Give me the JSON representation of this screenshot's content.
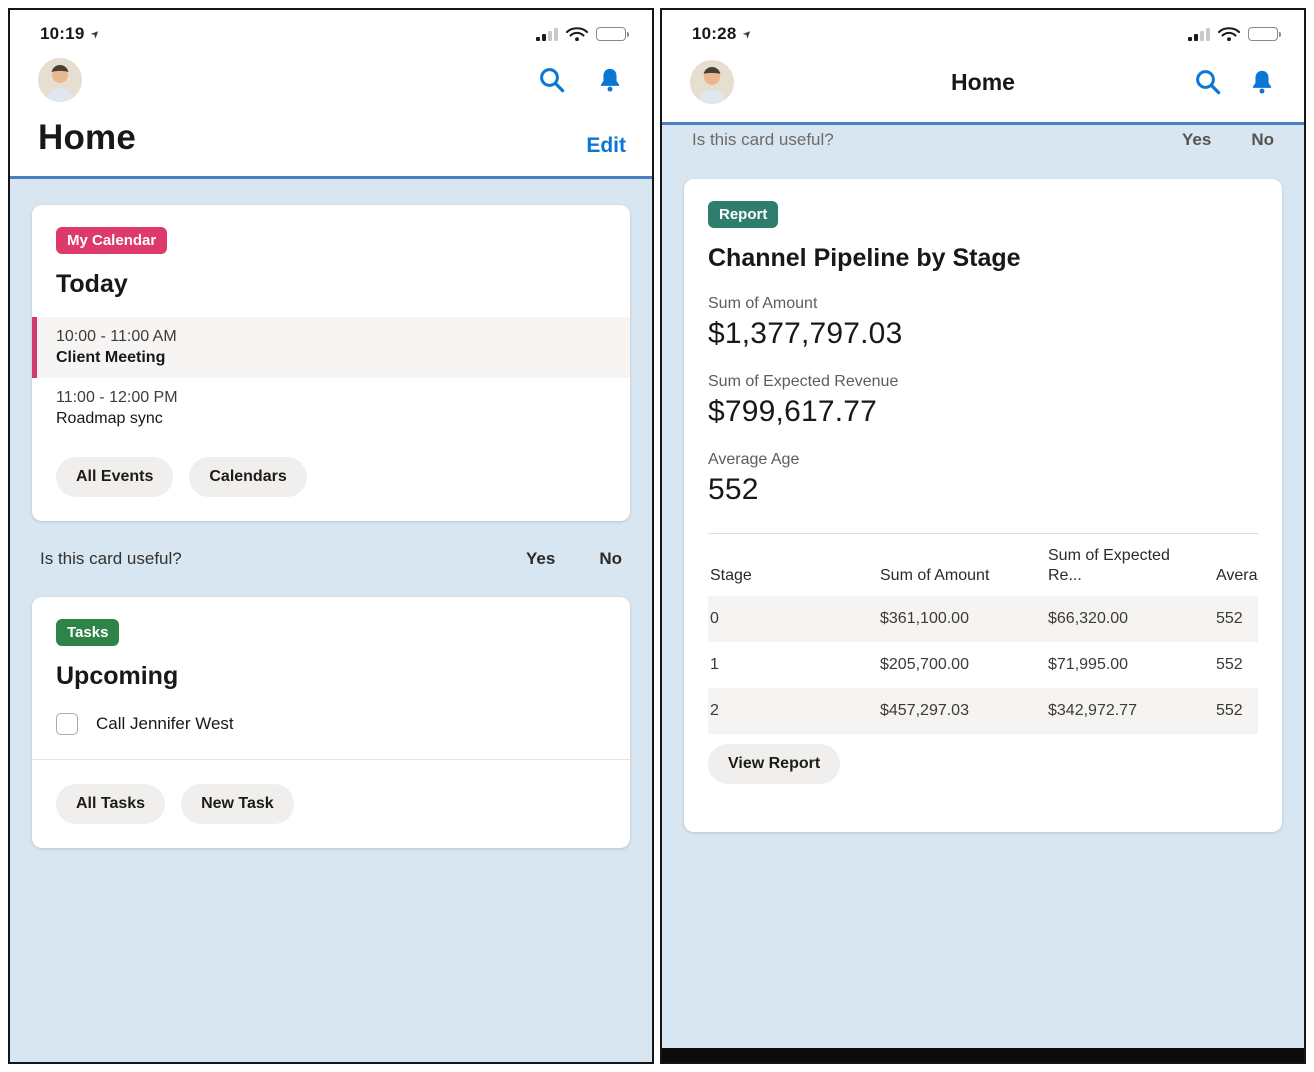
{
  "colors": {
    "brand_blue": "#0b76d3",
    "header_rule_blue": "#4a7fc0",
    "content_background": "#d8e6f2",
    "calendar_badge": "#dd3a6b",
    "tasks_badge": "#2e8447",
    "report_badge": "#2f7d6d",
    "event_highlight_bar": "#d13a6d"
  },
  "left_phone": {
    "status": {
      "time": "10:19"
    },
    "header": {
      "title": "Home",
      "edit_label": "Edit"
    },
    "calendar_card": {
      "badge": "My Calendar",
      "title": "Today",
      "events": [
        {
          "time": "10:00 - 11:00 AM",
          "name": "Client Meeting"
        },
        {
          "time": "11:00 - 12:00 PM",
          "name": "Roadmap sync"
        }
      ],
      "buttons": [
        "All Events",
        "Calendars"
      ]
    },
    "feedback": {
      "question": "Is this card useful?",
      "yes": "Yes",
      "no": "No"
    },
    "tasks_card": {
      "badge": "Tasks",
      "title": "Upcoming",
      "tasks": [
        {
          "label": "Call Jennifer West"
        }
      ],
      "buttons": [
        "All Tasks",
        "New Task"
      ]
    }
  },
  "right_phone": {
    "status": {
      "time": "10:28"
    },
    "header": {
      "title": "Home"
    },
    "feedback": {
      "question": "Is this card useful?",
      "yes": "Yes",
      "no": "No"
    },
    "report_card": {
      "badge": "Report",
      "title": "Channel Pipeline by Stage",
      "metrics": [
        {
          "label": "Sum of Amount",
          "value": "$1,377,797.03"
        },
        {
          "label": "Sum of Expected Revenue",
          "value": "$799,617.77"
        },
        {
          "label": "Average Age",
          "value": "552"
        }
      ],
      "table": {
        "headers": [
          "Stage",
          "Sum of Amount",
          "Sum of Expected Re...",
          "Averag"
        ],
        "rows": [
          [
            "0",
            "$361,100.00",
            "$66,320.00",
            "552"
          ],
          [
            "1",
            "$205,700.00",
            "$71,995.00",
            "552"
          ],
          [
            "2",
            "$457,297.03",
            "$342,972.77",
            "552"
          ]
        ]
      },
      "view_report_label": "View Report"
    }
  }
}
